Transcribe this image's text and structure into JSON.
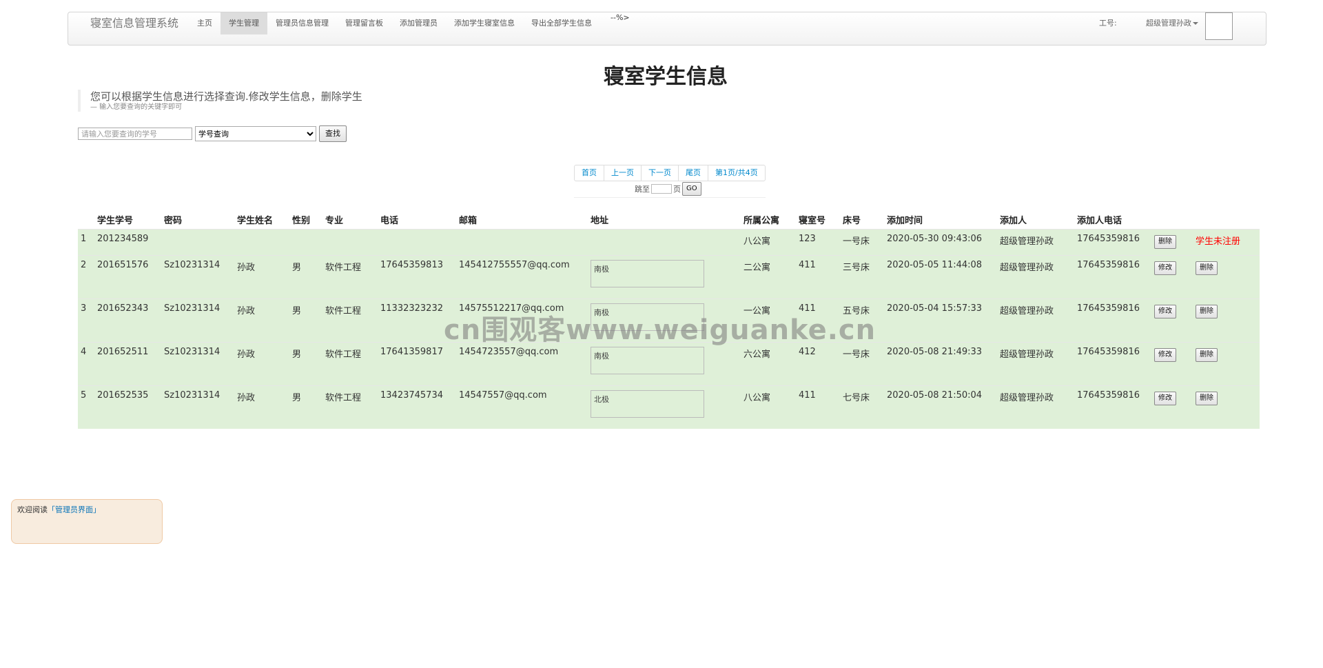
{
  "navbar": {
    "brand": "寝室信息管理系统",
    "items": [
      {
        "label": "主页",
        "active": false
      },
      {
        "label": "学生管理",
        "active": true
      },
      {
        "label": "管理员信息管理",
        "active": false
      },
      {
        "label": "管理留言板",
        "active": false
      },
      {
        "label": "添加管理员",
        "active": false
      },
      {
        "label": "添加学生寝室信息",
        "active": false
      },
      {
        "label": "导出全部学生信息",
        "active": false
      }
    ],
    "stray_text": "--%>",
    "employee_label": "工号:",
    "user_label": "超级管理孙政"
  },
  "page_title": "寝室学生信息",
  "lead": {
    "main": "您可以根据学生信息进行选择查询.修改学生信息，删除学生",
    "sub": "— 输入您要查询的关键字即可"
  },
  "search": {
    "placeholder": "请输入您要查询的学号",
    "select_value": "学号查询",
    "button": "查找"
  },
  "pagination": {
    "first": "首页",
    "prev": "上一页",
    "next": "下一页",
    "last": "尾页",
    "info": "第1页/共4页",
    "jump_label": "跳至",
    "jump_suffix": "页",
    "go": "GO"
  },
  "table": {
    "headers": [
      "",
      "学生学号",
      "密码",
      "学生姓名",
      "性别",
      "专业",
      "电话",
      "邮箱",
      "地址",
      "所属公寓",
      "寝室号",
      "床号",
      "添加时间",
      "添加人",
      "添加人电话",
      "",
      ""
    ],
    "edit_label": "修改",
    "delete_label": "删除",
    "unregistered_label": "学生未注册",
    "rows": [
      {
        "idx": "1",
        "id": "201234589",
        "pwd": "",
        "name": "",
        "gender": "",
        "major": "",
        "phone": "",
        "email": "",
        "address": "",
        "apartment": "八公寓",
        "room": "123",
        "bed": "一号床",
        "time": "2020-05-30 09:43:06",
        "adder": "超级管理孙政",
        "adder_phone": "17645359816"
      },
      {
        "idx": "2",
        "id": "201651576",
        "pwd": "Sz10231314",
        "name": "孙政",
        "gender": "男",
        "major": "软件工程",
        "phone": "17645359813",
        "email": "145412755557@qq.com",
        "address": "南极",
        "apartment": "二公寓",
        "room": "411",
        "bed": "三号床",
        "time": "2020-05-05 11:44:08",
        "adder": "超级管理孙政",
        "adder_phone": "17645359816"
      },
      {
        "idx": "3",
        "id": "201652343",
        "pwd": "Sz10231314",
        "name": "孙政",
        "gender": "男",
        "major": "软件工程",
        "phone": "11332323232",
        "email": "14575512217@qq.com",
        "address": "南极",
        "apartment": "一公寓",
        "room": "411",
        "bed": "五号床",
        "time": "2020-05-04 15:57:33",
        "adder": "超级管理孙政",
        "adder_phone": "17645359816"
      },
      {
        "idx": "4",
        "id": "201652511",
        "pwd": "Sz10231314",
        "name": "孙政",
        "gender": "男",
        "major": "软件工程",
        "phone": "17641359817",
        "email": "1454723557@qq.com",
        "address": "南极",
        "apartment": "六公寓",
        "room": "412",
        "bed": "一号床",
        "time": "2020-05-08 21:49:33",
        "adder": "超级管理孙政",
        "adder_phone": "17645359816"
      },
      {
        "idx": "5",
        "id": "201652535",
        "pwd": "Sz10231314",
        "name": "孙政",
        "gender": "男",
        "major": "软件工程",
        "phone": "13423745734",
        "email": "14547557@qq.com",
        "address": "北极",
        "apartment": "八公寓",
        "room": "411",
        "bed": "七号床",
        "time": "2020-05-08 21:50:04",
        "adder": "超级管理孙政",
        "adder_phone": "17645359816"
      }
    ]
  },
  "watermark": "cn围观客www.weiguanke.cn",
  "notice": {
    "prefix": "欢迎阅读",
    "link": "「管理员界面」"
  },
  "colors": {
    "row_bg": "#dff0d8",
    "link": "#0088cc",
    "unregistered": "#ff0000",
    "notice_bg": "#f8ecde"
  }
}
